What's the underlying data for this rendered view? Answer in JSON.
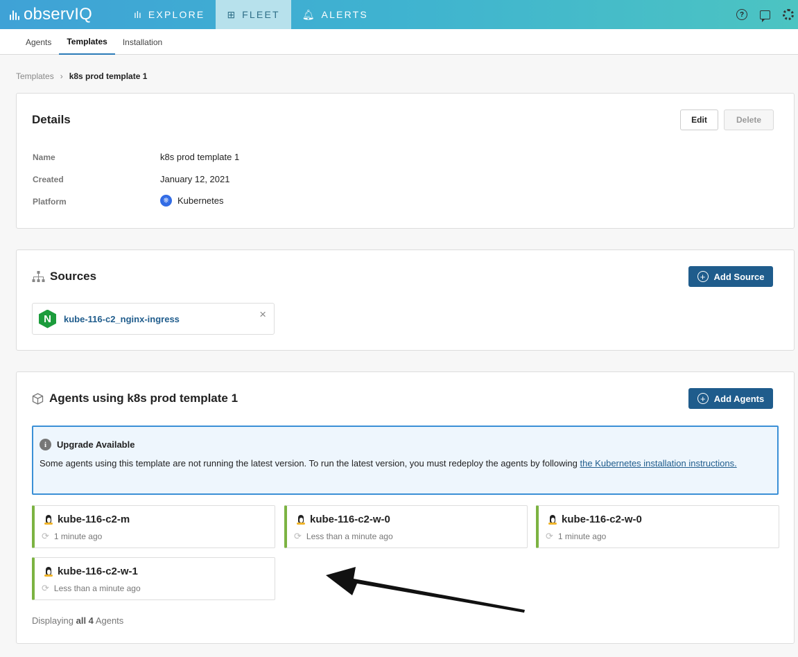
{
  "topnav": {
    "logo_text": "observIQ",
    "items": [
      {
        "label": "EXPLORE",
        "icon": "bar-chart-icon"
      },
      {
        "label": "FLEET",
        "icon": "grid-icon"
      },
      {
        "label": "ALERTS",
        "icon": "bell-icon"
      }
    ],
    "active": "FLEET",
    "right_icons": [
      "help-icon",
      "chat-icon",
      "settings-icon"
    ]
  },
  "subtabs": [
    {
      "label": "Agents"
    },
    {
      "label": "Templates"
    },
    {
      "label": "Installation"
    }
  ],
  "active_subtab": "Templates",
  "breadcrumb": {
    "parent": "Templates",
    "separator": "›",
    "current": "k8s prod template 1"
  },
  "details": {
    "title": "Details",
    "edit_label": "Edit",
    "delete_label": "Delete",
    "rows": [
      {
        "label": "Name",
        "value": "k8s prod template 1"
      },
      {
        "label": "Created",
        "value": "January 12, 2021"
      },
      {
        "label": "Platform",
        "value": "Kubernetes"
      }
    ]
  },
  "sources": {
    "title": "Sources",
    "add_label": "Add Source",
    "items": [
      {
        "name": "kube-116-c2_nginx-ingress",
        "icon_letter": "N"
      }
    ],
    "remove_glyph": "×"
  },
  "agents": {
    "title": "Agents using k8s prod template 1",
    "add_label": "Add Agents",
    "alert": {
      "title": "Upgrade Available",
      "body": "Some agents using this template are not running the latest version. To run the latest version, you must redeploy the agents by following ",
      "link_text": "the Kubernetes installation instructions."
    },
    "items": [
      {
        "name": "kube-116-c2-m",
        "time": "1 minute ago"
      },
      {
        "name": "kube-116-c2-w-0",
        "time": "Less than a minute ago"
      },
      {
        "name": "kube-116-c2-w-0",
        "time": "1 minute ago"
      },
      {
        "name": "kube-116-c2-w-1",
        "time": "Less than a minute ago"
      }
    ],
    "footer": {
      "prefix": "Displaying",
      "bold": "all 4",
      "suffix": "Agents"
    }
  },
  "colors": {
    "accent": "#1f5c8c",
    "status_green": "#7cb342",
    "alert_border": "#3a8fd6"
  }
}
